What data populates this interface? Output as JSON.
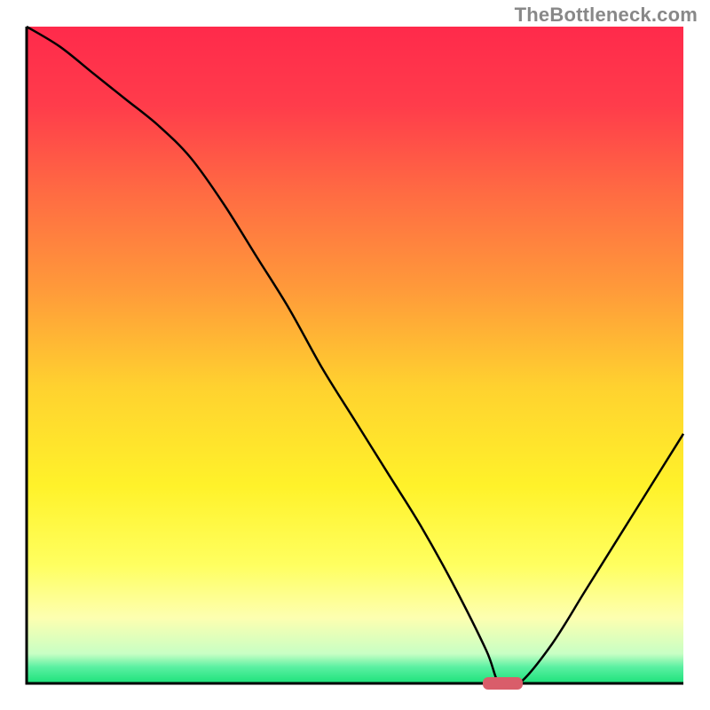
{
  "watermark": "TheBottleneck.com",
  "chart_data": {
    "type": "line",
    "title": "",
    "xlabel": "",
    "ylabel": "",
    "xlim": [
      0,
      100
    ],
    "ylim": [
      0,
      100
    ],
    "x": [
      0,
      5,
      10,
      15,
      20,
      25,
      30,
      35,
      40,
      45,
      50,
      55,
      60,
      65,
      70,
      72,
      75,
      80,
      85,
      90,
      95,
      100
    ],
    "values": [
      100,
      97,
      93,
      89,
      85,
      80,
      73,
      65,
      57,
      48,
      40,
      32,
      24,
      15,
      5,
      0,
      0,
      6,
      14,
      22,
      30,
      38
    ],
    "minimum_region": {
      "x_start": 70,
      "x_end": 75,
      "value": 0
    },
    "background": {
      "type": "vertical-gradient",
      "stops": [
        {
          "pos": 0.0,
          "color": "#ff2a4b"
        },
        {
          "pos": 0.12,
          "color": "#ff3c4b"
        },
        {
          "pos": 0.25,
          "color": "#ff6a43"
        },
        {
          "pos": 0.4,
          "color": "#ff9a3a"
        },
        {
          "pos": 0.55,
          "color": "#ffd22f"
        },
        {
          "pos": 0.7,
          "color": "#fff22a"
        },
        {
          "pos": 0.82,
          "color": "#ffff60"
        },
        {
          "pos": 0.9,
          "color": "#fdffb0"
        },
        {
          "pos": 0.955,
          "color": "#c8ffc4"
        },
        {
          "pos": 0.975,
          "color": "#5bf0a2"
        },
        {
          "pos": 1.0,
          "color": "#1ce27a"
        }
      ]
    }
  }
}
